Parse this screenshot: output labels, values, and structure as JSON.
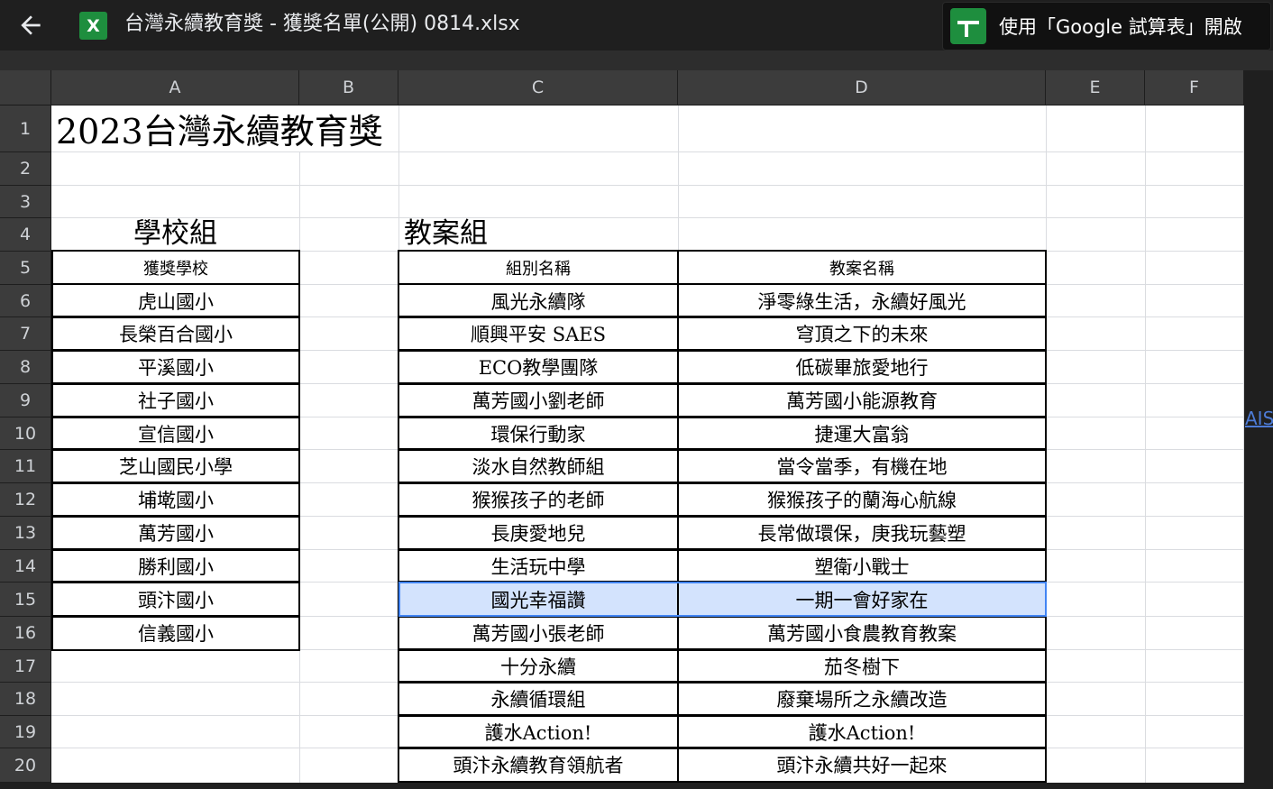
{
  "app": {
    "file_name": "台灣永續教育獎 - 獲獎名單(公開) 0814.xlsx",
    "file_icon_letter": "X",
    "open_button_label": "使用「Google 試算表」開啟",
    "side_link": "AIS",
    "icons": {
      "back": "arrow-left-icon",
      "file": "excel-file-icon",
      "sheets": "google-sheets-icon"
    },
    "colors": {
      "accent_green": "#1e8e3e",
      "selection_border": "#4285f4",
      "selection_fill": "#d3e3fd"
    }
  },
  "grid": {
    "columns": [
      "A",
      "B",
      "C",
      "D",
      "E",
      "F"
    ],
    "rows": [
      "1",
      "2",
      "3",
      "4",
      "5",
      "6",
      "7",
      "8",
      "9",
      "10",
      "11",
      "12",
      "13",
      "14",
      "15",
      "16",
      "17",
      "18",
      "19",
      "20"
    ],
    "title": "2023台灣永續教育獎",
    "school": {
      "heading": "學校組",
      "column_header": "獲獎學校",
      "items": [
        "虎山國小",
        "長榮百合國小",
        "平溪國小",
        "社子國小",
        "宣信國小",
        "芝山國民小學",
        "埔墘國小",
        "萬芳國小",
        "勝利國小",
        "頭汴國小",
        "信義國小"
      ]
    },
    "lesson": {
      "heading": "教案組",
      "header_team": "組別名稱",
      "header_plan": "教案名稱",
      "rows": [
        {
          "team": "風光永續隊",
          "plan": "淨零綠生活，永續好風光"
        },
        {
          "team": "順興平安 SAES",
          "plan": "穹頂之下的未來"
        },
        {
          "team": "ECO教學團隊",
          "plan": "低碳畢旅愛地行"
        },
        {
          "team": "萬芳國小劉老師",
          "plan": "萬芳國小能源教育"
        },
        {
          "team": "環保行動家",
          "plan": "捷運大富翁"
        },
        {
          "team": "淡水自然教師組",
          "plan": "當令當季，有機在地"
        },
        {
          "team": "猴猴孩子的老師",
          "plan": "猴猴孩子的蘭海心航線"
        },
        {
          "team": "長庚愛地兒",
          "plan": "長常做環保，庚我玩藝塑"
        },
        {
          "team": "生活玩中學",
          "plan": "塑衛小戰士"
        },
        {
          "team": "國光幸福讚",
          "plan": "一期一會好家在"
        },
        {
          "team": "萬芳國小張老師",
          "plan": "萬芳國小食農教育教案"
        },
        {
          "team": "十分永續",
          "plan": "茄冬樹下"
        },
        {
          "team": "永續循環組",
          "plan": "廢棄場所之永續改造"
        },
        {
          "team": "護水Action!",
          "plan": "護水Action!"
        },
        {
          "team": "頭汴永續教育領航者",
          "plan": "頭汴永續共好一起來"
        }
      ]
    },
    "selected_row": "15"
  }
}
